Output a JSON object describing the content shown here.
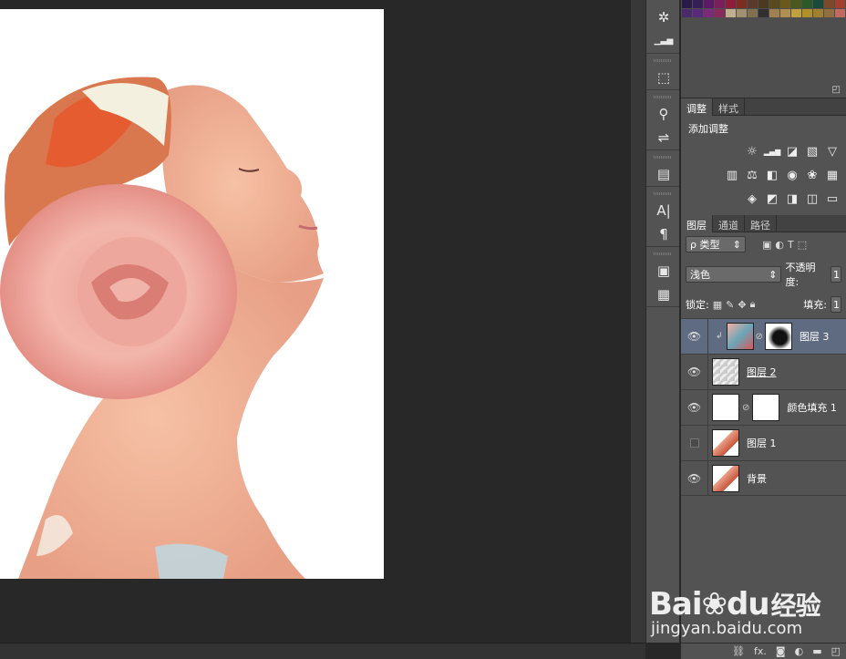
{
  "dock_icons": [
    "compass-icon",
    "histogram-icon",
    "cube-icon",
    "brush-preset-icon",
    "clone-source-icon",
    "layer-comps-icon",
    "character-icon",
    "paragraph-icon",
    "notes-icon",
    "properties-icon"
  ],
  "dock_glyphs": [
    "✲",
    "▁▃▅",
    "⬚",
    "⚲",
    "⇌",
    "▤",
    "A|",
    "¶",
    "▣",
    "▦"
  ],
  "swatch_colors": [
    "#2a1a48",
    "#361f55",
    "#5a1a66",
    "#7a1f5a",
    "#8e1c3a",
    "#7a2e22",
    "#5a3a2a",
    "#4a3a22",
    "#5a4a1e",
    "#6a5a1a",
    "#4a5a1e",
    "#2a5a2a",
    "#1a4a3a",
    "#7a4a2a",
    "#a04030",
    "#4a2a6a",
    "#5a2a7a",
    "#7a2a7a",
    "#8a2a5a",
    "#c0b090",
    "#a09070",
    "#807050",
    "#303030",
    "#a08050",
    "#b09050",
    "#c0a040",
    "#b0902a",
    "#a08030",
    "#907040",
    "#c06a60"
  ],
  "adjustments": {
    "tabs": [
      "调整",
      "样式"
    ],
    "title": "添加调整",
    "row1": [
      "☼",
      "▂▄▆",
      "◪",
      "▧",
      "▽"
    ],
    "row2": [
      "▥",
      "⚖",
      "◧",
      "◉",
      "❀",
      "▦"
    ],
    "row3": [
      "◈",
      "◩",
      "◨",
      "◫",
      "▭"
    ]
  },
  "layers_panel": {
    "tabs": [
      "图层",
      "通道",
      "路径"
    ],
    "filter_label": "ρ 类型",
    "blend_mode": "浅色",
    "opacity_label": "不透明度:",
    "opacity_value": "1",
    "lock_label": "锁定:",
    "fill_label": "填充:",
    "fill_value": "1",
    "layers": [
      {
        "name": "图层 3",
        "visible": true,
        "selected": true
      },
      {
        "name": "图层 2",
        "visible": true,
        "selected": false
      },
      {
        "name": "颜色填充 1",
        "visible": true,
        "selected": false
      },
      {
        "name": "图层 1",
        "visible": false,
        "selected": false
      },
      {
        "name": "背景",
        "visible": true,
        "selected": false
      }
    ],
    "footer_icons": [
      "⛓",
      "fx.",
      "◙",
      "◐",
      "▬",
      "◰"
    ]
  },
  "watermark": {
    "brand": "Bai",
    "brand2": "du",
    "cn": "经验",
    "url": "jingyan.baidu.com"
  }
}
